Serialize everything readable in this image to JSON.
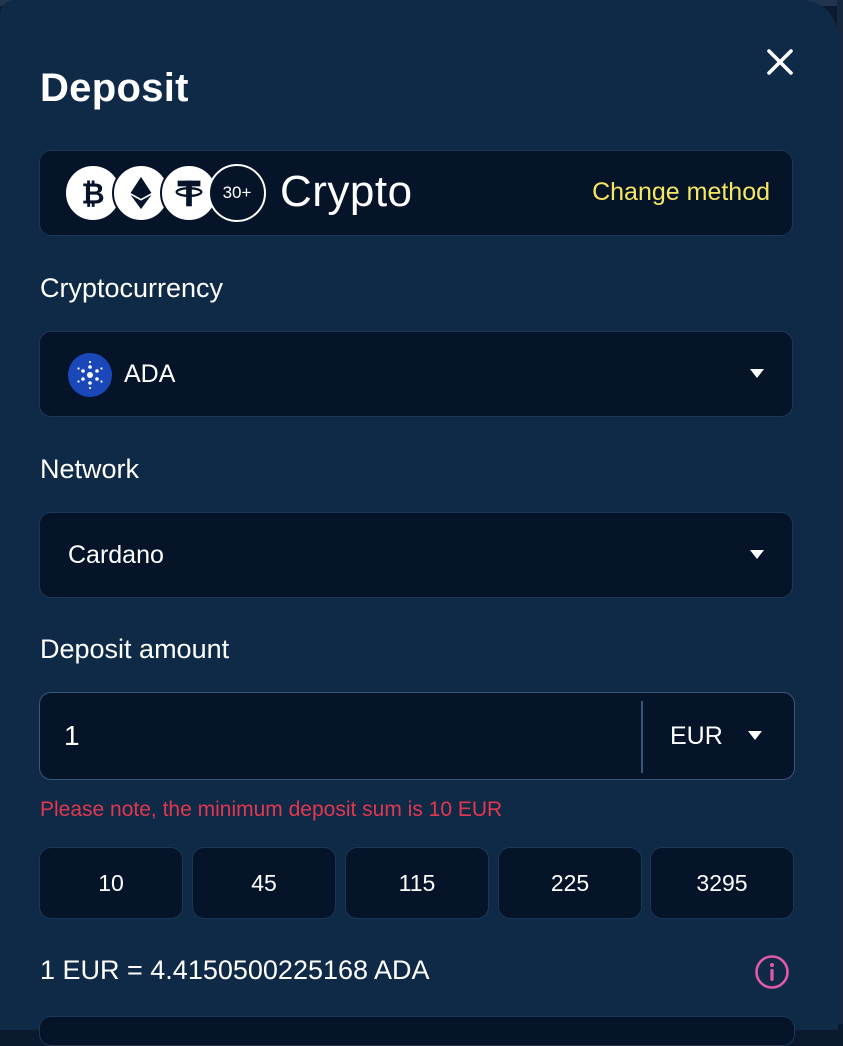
{
  "modal": {
    "title": "Deposit"
  },
  "method": {
    "name": "Crypto",
    "more_badge": "30+",
    "change_label": "Change method",
    "coin_icons": [
      "bitcoin-icon",
      "ethereum-icon",
      "tether-icon"
    ]
  },
  "cryptocurrency": {
    "label": "Cryptocurrency",
    "selected": "ADA",
    "icon": "cardano-icon"
  },
  "network": {
    "label": "Network",
    "selected": "Cardano"
  },
  "deposit": {
    "label": "Deposit amount",
    "amount": "1",
    "currency": "EUR",
    "warning": "Please note, the minimum deposit sum is 10 EUR",
    "presets": [
      "10",
      "45",
      "115",
      "225",
      "3295"
    ]
  },
  "rate": {
    "text": "1 EUR = 4.4150500225168 ADA"
  },
  "colors": {
    "background": "#0f2a47",
    "field": "#06142a",
    "accent_yellow": "#f5e663",
    "warning_red": "#e2374f",
    "info_pink": "#e05aa8"
  }
}
